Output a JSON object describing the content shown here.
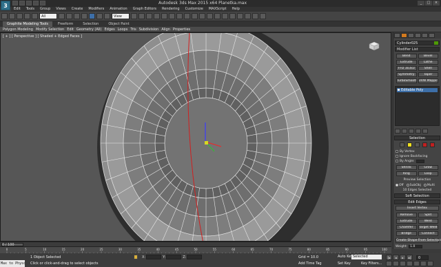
{
  "title": "Autodesk 3ds Max 2015 x64    Planetka.max",
  "app_logo": "3",
  "menu": [
    "Edit",
    "Tools",
    "Group",
    "Views",
    "Create",
    "Modifiers",
    "Animation",
    "Graph Editors",
    "Rendering",
    "Customize",
    "MAXScript",
    "Help"
  ],
  "toolbar": {
    "selection_filter": "All",
    "ref_coord": "View"
  },
  "ribbon_tabs": [
    "Graphite Modeling Tools",
    "Freeform",
    "Selection",
    "Object Paint"
  ],
  "ribbon_items": [
    "Polygon Modeling",
    "Modify Selection",
    "Edit",
    "Geometry (All)",
    "Edges",
    "Loops",
    "Tris",
    "Subdivision",
    "Align",
    "Properties"
  ],
  "viewport": {
    "label": "[ + ] [ Perspective ] [ Shaded + Edged Faces ]"
  },
  "command_panel": {
    "object_name": "Cylinder025",
    "modifier_list": "Modifier List",
    "modifier_buttons": [
      "Bend",
      "Bevel",
      "Extrude",
      "Lathe",
      "FFD 3x3x3",
      "Shell",
      "Symmetry",
      "Taper",
      "TurboSmooth",
      "UVW Mapping Cle"
    ],
    "stack_item": "Editable Poly",
    "selection_rollout": "Selection",
    "by_vertex": "By Vertex",
    "ignore_backfacing": "Ignore Backfacing",
    "by_angle": "By Angle:",
    "shrink": "Shrink",
    "grow": "Grow",
    "ring": "Ring",
    "loop": "Loop",
    "preview_selection": "Preview Selection",
    "preview_opts": [
      "Off",
      "SubObj",
      "Multi"
    ],
    "edges_selected": "10 Edges Selected",
    "soft_selection": "Soft Selection",
    "edit_edges": "Edit Edges",
    "insert_vertex": "Insert Vertex",
    "remove": "Remove",
    "split": "Split",
    "extrude": "Extrude",
    "weld": "Weld",
    "chamfer": "Chamfer",
    "target_weld": "Target Weld",
    "bridge": "Bridge",
    "connect": "Connect",
    "create_shape": "Create Shape From Selection",
    "weight_label": "Weight:",
    "weight_value": "1.0"
  },
  "timeslider": {
    "label": "0 / 100",
    "position": 0
  },
  "trackbar": {
    "ticks": [
      "0",
      "5",
      "10",
      "15",
      "20",
      "25",
      "30",
      "35",
      "40",
      "45",
      "50",
      "55",
      "60",
      "65",
      "70",
      "75",
      "80",
      "85",
      "90",
      "95",
      "100"
    ]
  },
  "status": {
    "maxscript": "Max to Physc",
    "selected": "1 Object Selected",
    "prompt": "Click or click-and-drag to select objects",
    "x_label": "X:",
    "y_label": "Y:",
    "z_label": "Z:",
    "grid": "Grid = 10.0",
    "add_time_tag": "Add Time Tag",
    "auto_key": "Auto Key",
    "selected_dropdown": "Selected",
    "set_key": "Set Key",
    "key_filters": "Key Filters...",
    "frame": "0"
  }
}
